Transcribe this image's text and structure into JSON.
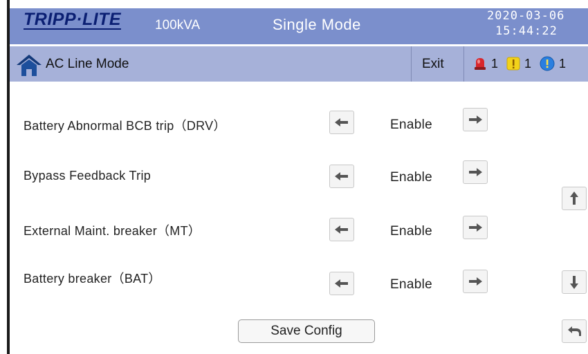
{
  "header": {
    "brand": "TRIPP·LITE",
    "model": "100kVA",
    "mode": "Single Mode",
    "date": "2020-03-06",
    "time": "15:44:22"
  },
  "subbar": {
    "title": "AC Line Mode",
    "exit_label": "Exit",
    "alarms": [
      {
        "type": "critical-alarm",
        "count": "1",
        "color": "#d8262c"
      },
      {
        "type": "warning-alarm",
        "count": "1",
        "color": "#f2d21a"
      },
      {
        "type": "info-alarm",
        "count": "1",
        "color": "#2a7fe0"
      }
    ]
  },
  "settings": [
    {
      "label": "Battery Abnormal BCB trip（DRV）",
      "value": "Enable"
    },
    {
      "label": "Bypass Feedback Trip",
      "value": "Enable"
    },
    {
      "label": "External Maint.  breaker（MT）",
      "value": "Enable"
    },
    {
      "label": "Battery breaker（BAT）",
      "value": "Enable"
    }
  ],
  "actions": {
    "save_label": "Save Config"
  },
  "colors": {
    "header_bg": "#7b8fcc",
    "subbar_bg": "#a6b1d9",
    "brand": "#0b1f73"
  },
  "icons": {
    "home": "home-icon",
    "left": "arrow-left-icon",
    "right": "arrow-right-icon",
    "up": "arrow-up-icon",
    "down": "arrow-down-icon",
    "back": "back-return-icon"
  }
}
